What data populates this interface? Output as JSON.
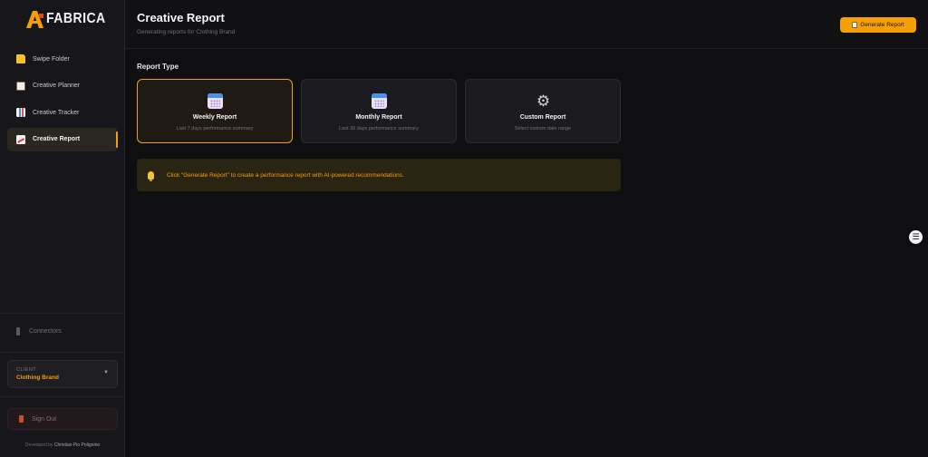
{
  "brand": {
    "logo_text": "FABRICA",
    "accent": "#f5a000"
  },
  "sidebar": {
    "items": [
      {
        "label": "Swipe Folder",
        "icon": "folder-icon",
        "active": false
      },
      {
        "label": "Creative Planner",
        "icon": "clipboard-icon",
        "active": false
      },
      {
        "label": "Creative Tracker",
        "icon": "bar-chart-icon",
        "active": false
      },
      {
        "label": "Creative Report",
        "icon": "line-chart-icon",
        "active": true
      }
    ],
    "connectors_label": "Connectors",
    "client": {
      "label": "CLIENT",
      "value": "Clothing Brand"
    },
    "signout_label": "Sign Out",
    "developed_by_prefix": "Developed by",
    "developed_by_name": "Christian Pio Polignino"
  },
  "header": {
    "title": "Creative Report",
    "subtitle": "Generating reports for Clothing Brand",
    "generate_button": "Generate Report"
  },
  "main": {
    "section_label": "Report Type",
    "report_types": [
      {
        "title": "Weekly Report",
        "description": "Last 7 days performance summary",
        "icon": "calendar-icon",
        "selected": true
      },
      {
        "title": "Monthly Report",
        "description": "Last 30 days performance summary",
        "icon": "calendar-icon",
        "selected": false
      },
      {
        "title": "Custom Report",
        "description": "Select custom date range",
        "icon": "gear-icon",
        "selected": false
      }
    ],
    "tip": "Click \"Generate Report\" to create a performance report with AI-powered recommendations."
  }
}
